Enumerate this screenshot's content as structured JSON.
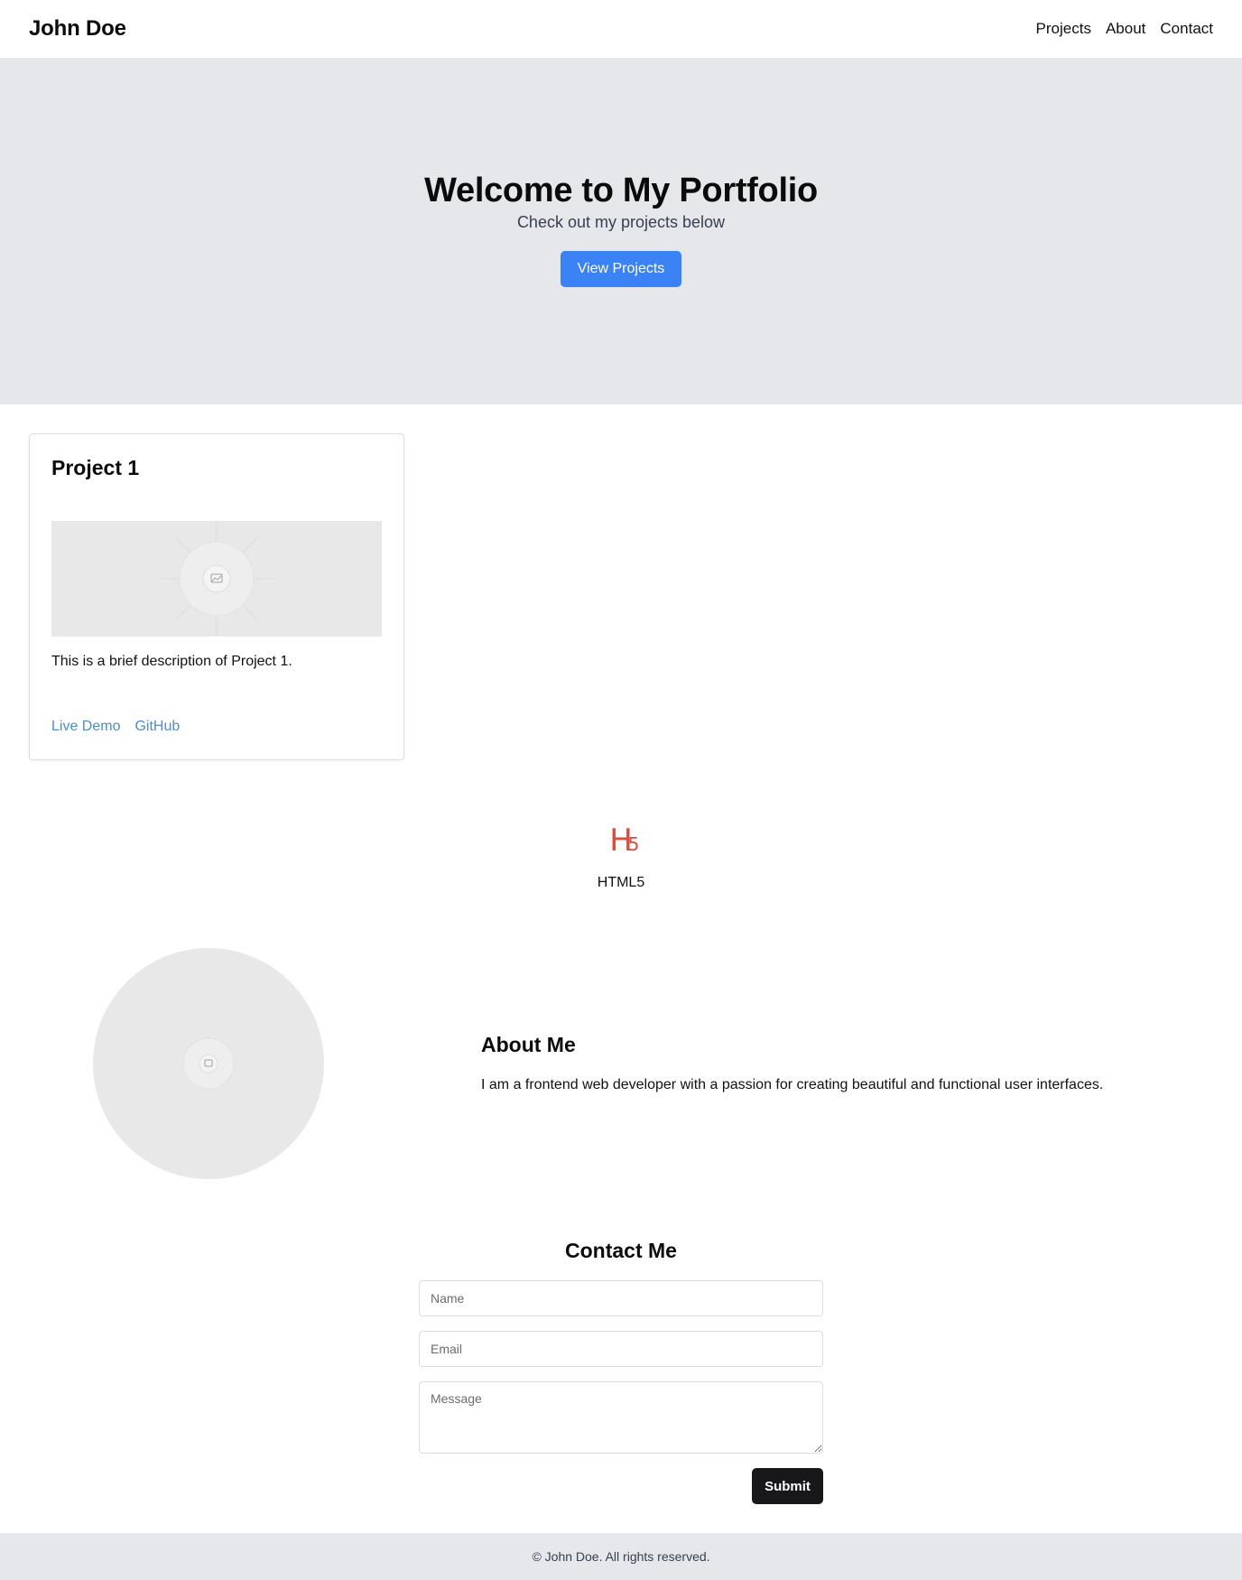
{
  "navbar": {
    "brand": "John Doe",
    "links": [
      "Projects",
      "About",
      "Contact"
    ]
  },
  "hero": {
    "title": "Welcome to My Portfolio",
    "subtitle": "Check out my projects below",
    "button_label": "View Projects"
  },
  "projects": [
    {
      "title": "Project 1",
      "image_icon": "image-placeholder-icon",
      "description": "This is a brief description of Project 1.",
      "links": [
        "Live Demo",
        "GitHub"
      ]
    }
  ],
  "skills": [
    {
      "icon": "html5-icon",
      "label": "HTML5"
    }
  ],
  "about": {
    "photo_icon": "image-placeholder-icon",
    "heading": "About Me",
    "text": "I am a frontend web developer with a passion for creating beautiful and functional user interfaces."
  },
  "contact": {
    "heading": "Contact Me",
    "name_placeholder": "Name",
    "email_placeholder": "Email",
    "message_placeholder": "Message",
    "submit_label": "Submit"
  },
  "footer": {
    "text": "© John Doe. All rights reserved."
  },
  "colors": {
    "primary": "#3b82f6",
    "hero_bg": "#e5e7eb",
    "link": "#4a8bd6",
    "html5": "#e34f26",
    "submit_bg": "#18181b"
  }
}
